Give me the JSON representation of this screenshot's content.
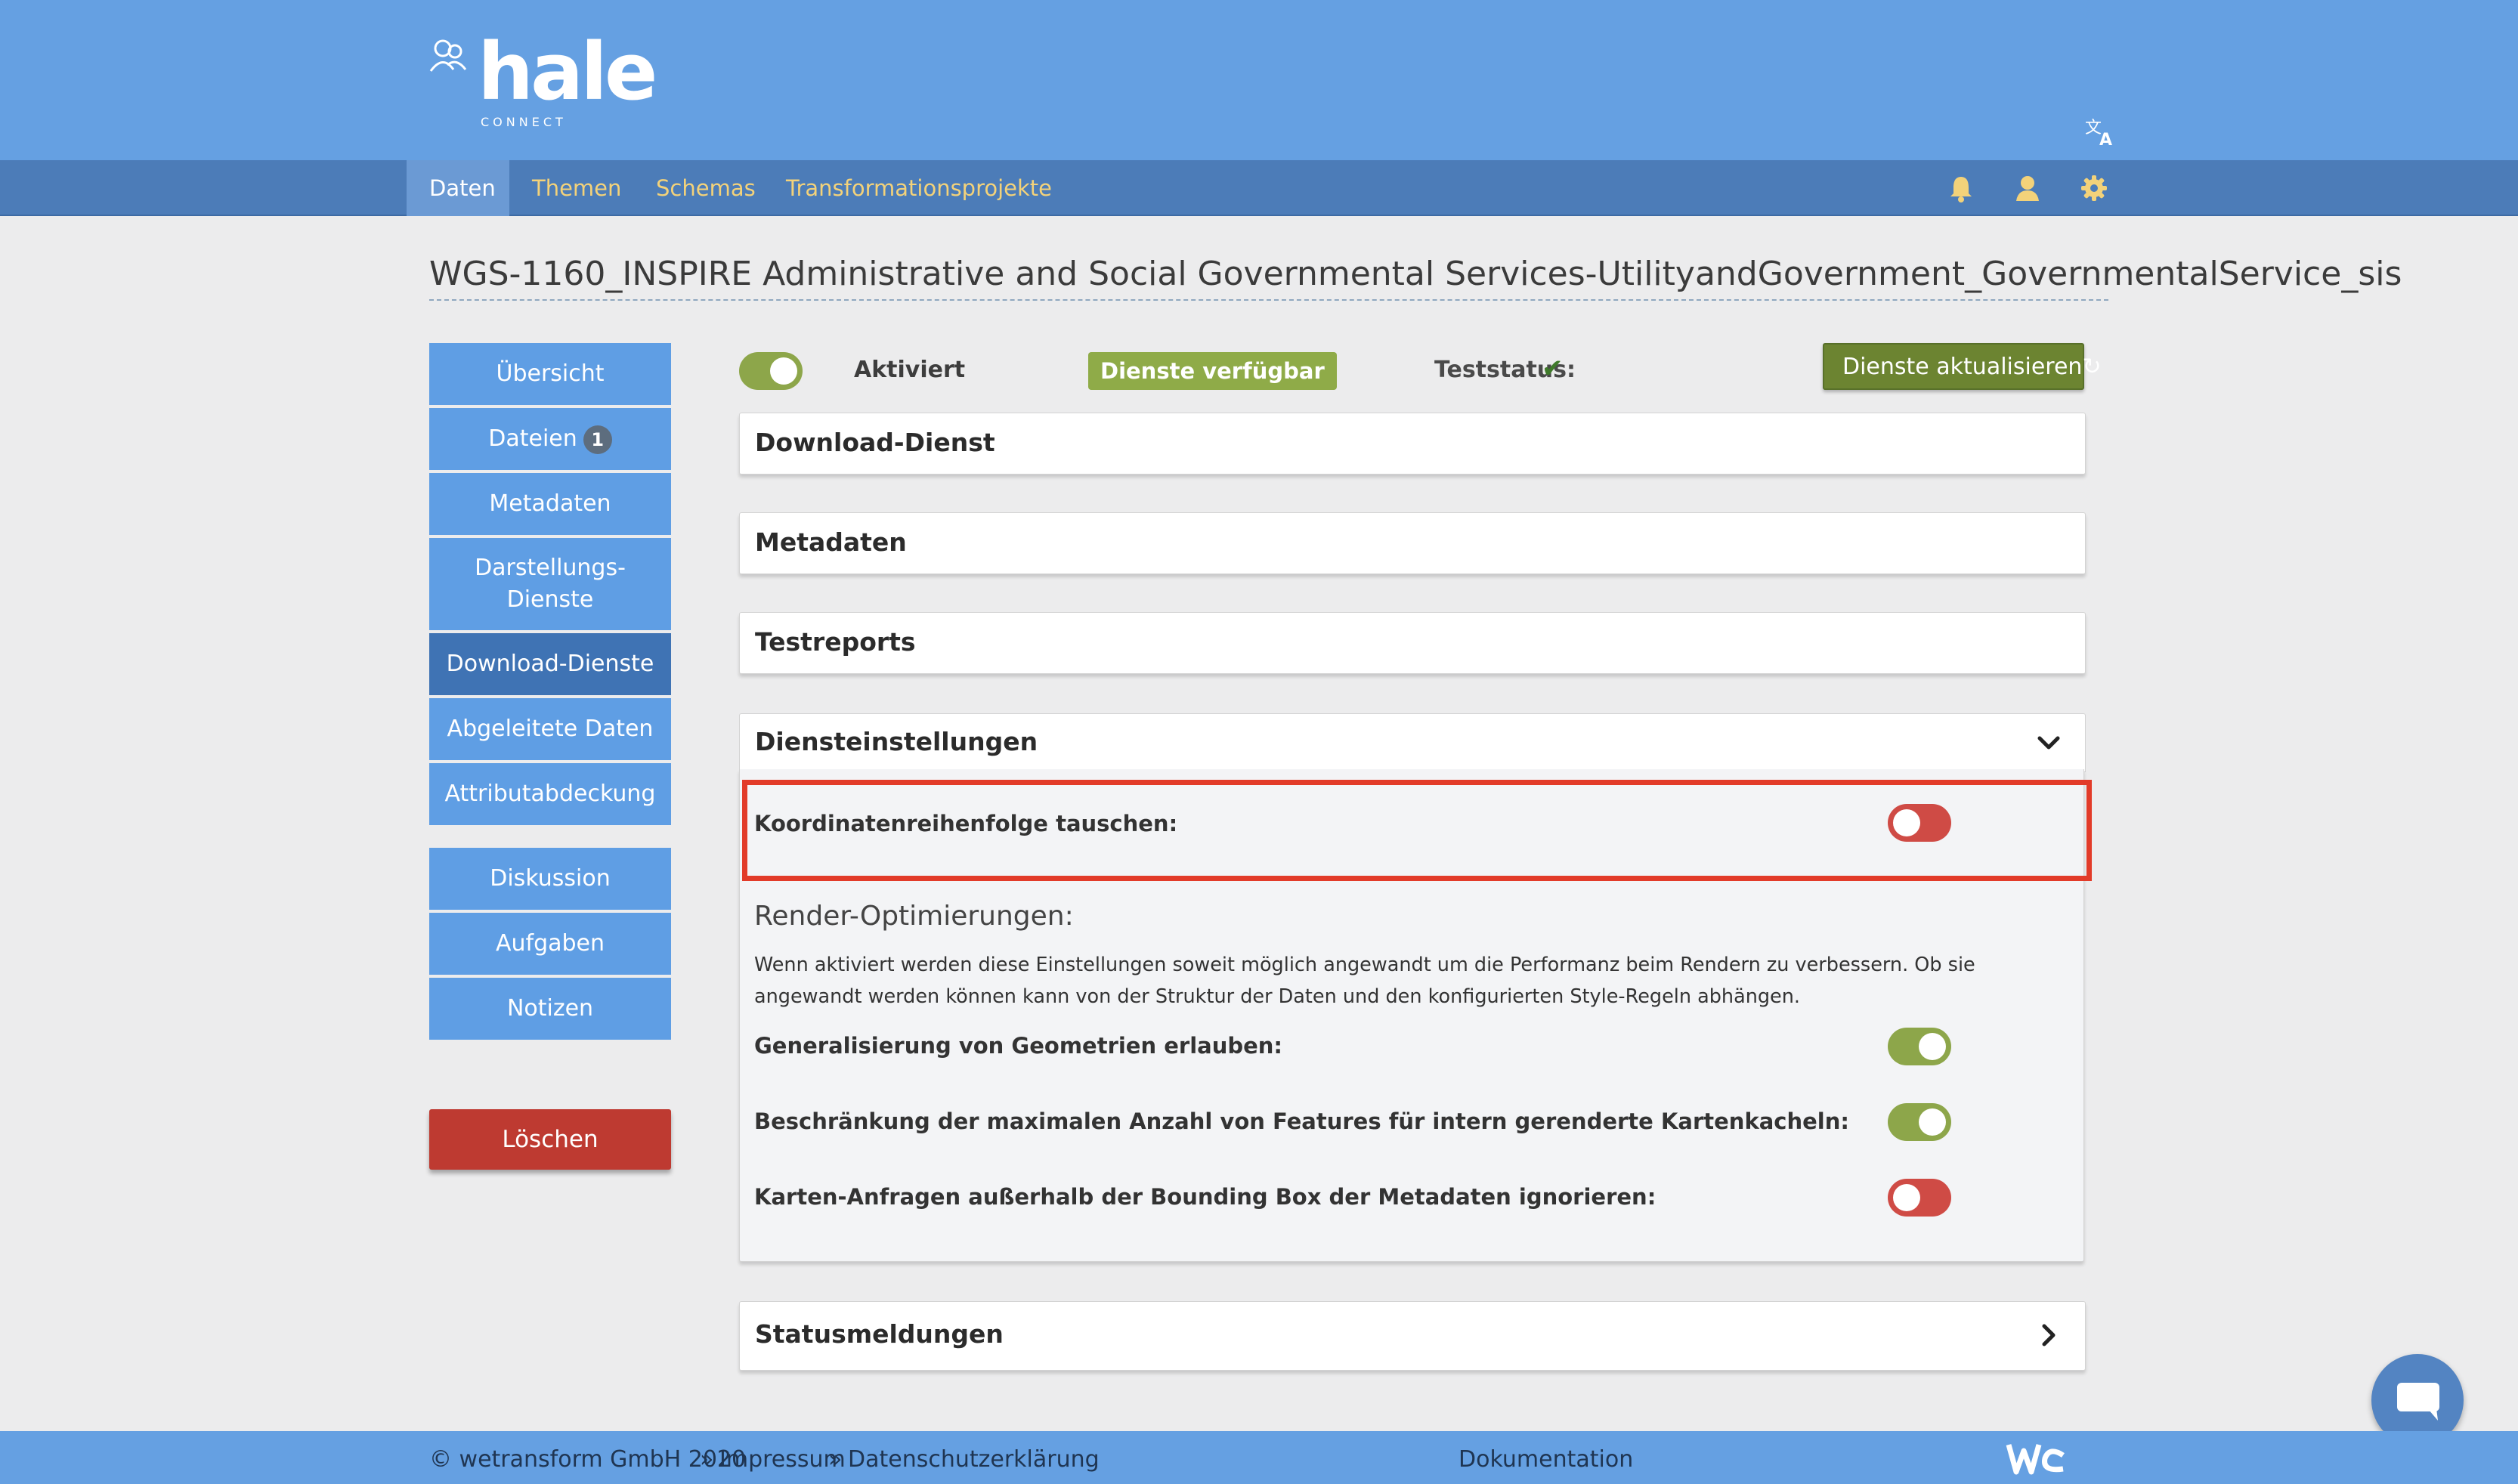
{
  "brand": {
    "logo_word": "hale",
    "logo_sub": "CONNECT"
  },
  "nav": {
    "items": [
      {
        "label": "Daten",
        "active": true
      },
      {
        "label": "Themen",
        "active": false
      },
      {
        "label": "Schemas",
        "active": false
      },
      {
        "label": "Transformationsprojekte",
        "active": false
      }
    ],
    "icons": [
      "bell-icon",
      "user-icon",
      "gear-icon"
    ],
    "lang_icon": "translate-icon"
  },
  "page": {
    "title": "WGS-1160_INSPIRE Administrative and Social Governmental Services-UtilityandGovernment_GovernmentalService_sis"
  },
  "sidebar": {
    "items": [
      {
        "label": "Übersicht"
      },
      {
        "label": "Dateien",
        "badge": "1"
      },
      {
        "label": "Metadaten"
      },
      {
        "label": "Darstellungs-",
        "label2": "Dienste"
      },
      {
        "label": "Download-Dienste",
        "active": true
      },
      {
        "label": "Abgeleitete Daten"
      },
      {
        "label": "Attributabdeckung"
      },
      {
        "label": "Diskussion"
      },
      {
        "label": "Aufgaben"
      },
      {
        "label": "Notizen"
      }
    ],
    "delete_label": "Löschen"
  },
  "status": {
    "activated_label": "Aktiviert",
    "activated": true,
    "services_badge": "Dienste verfügbar",
    "teststatus_label": "Teststatus:",
    "teststatus_ok": true,
    "refresh_label": "Dienste aktualisieren"
  },
  "panels": {
    "download": "Download-Dienst",
    "metadata": "Metadaten",
    "testreports": "Testreports",
    "settings": "Diensteinstellungen",
    "statusmessages": "Statusmeldungen"
  },
  "settings": {
    "swap_coords": {
      "label": "Koordinatenreihenfolge tauschen:",
      "enabled": false
    },
    "render_heading": "Render-Optimierungen:",
    "render_desc": "Wenn aktiviert werden diese Einstellungen soweit möglich angewandt um die Performanz beim Rendern zu verbessern. Ob sie angewandt werden können kann von der Struktur der Daten und den konfigurierten Style-Regeln abhängen.",
    "generalize": {
      "label": "Generalisierung von Geometrien erlauben:",
      "enabled": true
    },
    "limit_features": {
      "label": "Beschränkung der maximalen Anzahl von Features für intern gerenderte Kartenkacheln:",
      "enabled": true
    },
    "ignore_bbox": {
      "label": "Karten-Anfragen außerhalb der Bounding Box der Metadaten ignorieren:",
      "enabled": false
    }
  },
  "footer": {
    "copyright": "© wetransform GmbH 2020",
    "sep1": "»",
    "impressum": "Impressum",
    "sep2": "»",
    "privacy": "Datenschutzerklärung",
    "docs": "Dokumentation"
  },
  "colors": {
    "header": "#65a0e2",
    "nav": "#4c7cb8",
    "sidebar": "#5f9ee4",
    "sidebar_active": "#3f73b4",
    "toggle_on": "#8da64a",
    "toggle_off": "#cf4b45",
    "delete": "#be3a31",
    "highlight": "#e23b29"
  }
}
